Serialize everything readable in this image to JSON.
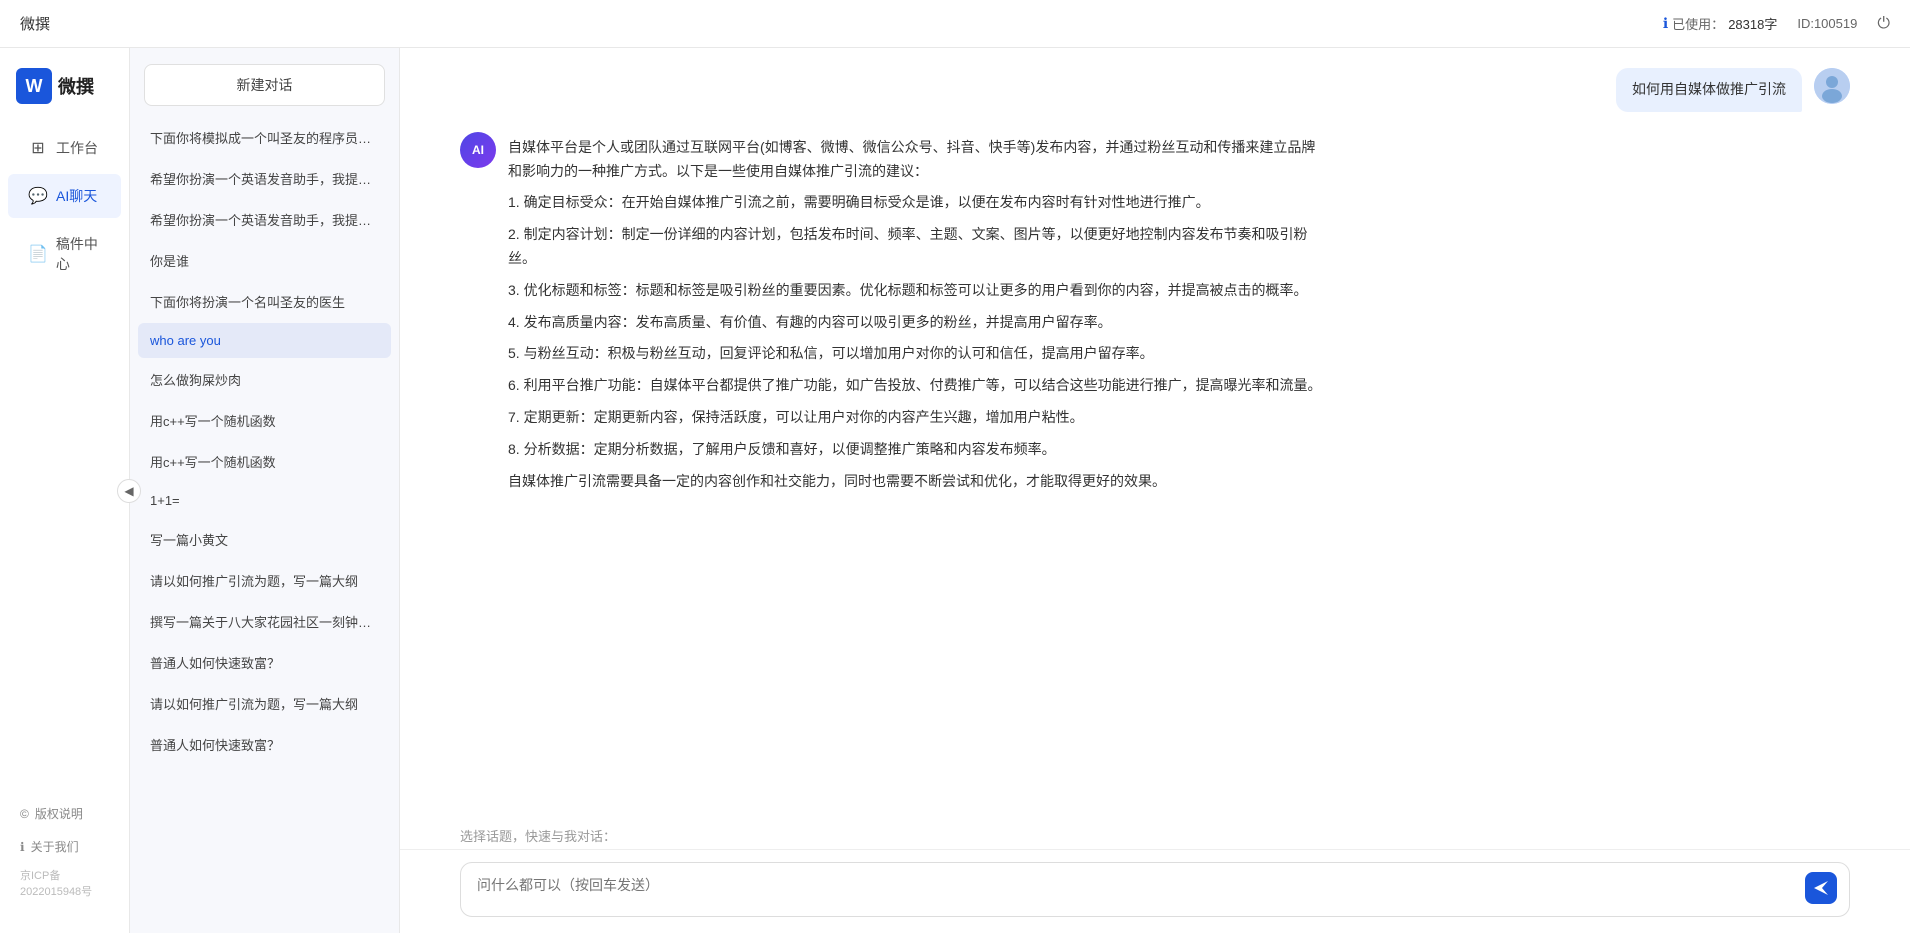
{
  "topbar": {
    "title": "微撰",
    "usage_label": "已使用：",
    "usage_value": "28318字",
    "id_label": "ID:100519",
    "logout_icon": "⏻"
  },
  "brand": {
    "logo_text": "W",
    "name": "微撰"
  },
  "nav": {
    "items": [
      {
        "id": "workbench",
        "label": "工作台",
        "icon": "⊞"
      },
      {
        "id": "aichat",
        "label": "AI聊天",
        "icon": "💬"
      },
      {
        "id": "drafts",
        "label": "稿件中心",
        "icon": "📄"
      }
    ],
    "bottom": [
      {
        "id": "copyright",
        "label": "版权说明",
        "icon": "©"
      },
      {
        "id": "about",
        "label": "关于我们",
        "icon": "ℹ"
      }
    ],
    "icp": "京ICP备2022015948号"
  },
  "sidebar": {
    "new_chat": "新建对话",
    "history": [
      {
        "id": 1,
        "label": "下面你将模拟成一个叫圣友的程序员，我说...",
        "active": false
      },
      {
        "id": 2,
        "label": "希望你扮演一个英语发音助手，我提供给你...",
        "active": false
      },
      {
        "id": 3,
        "label": "希望你扮演一个英语发音助手，我提供给你...",
        "active": false
      },
      {
        "id": 4,
        "label": "你是谁",
        "active": false
      },
      {
        "id": 5,
        "label": "下面你将扮演一个名叫圣友的医生",
        "active": false
      },
      {
        "id": 6,
        "label": "who are you",
        "active": true
      },
      {
        "id": 7,
        "label": "怎么做狗屎炒肉",
        "active": false
      },
      {
        "id": 8,
        "label": "用c++写一个随机函数",
        "active": false
      },
      {
        "id": 9,
        "label": "用c++写一个随机函数",
        "active": false
      },
      {
        "id": 10,
        "label": "1+1=",
        "active": false
      },
      {
        "id": 11,
        "label": "写一篇小黄文",
        "active": false
      },
      {
        "id": 12,
        "label": "请以如何推广引流为题，写一篇大纲",
        "active": false
      },
      {
        "id": 13,
        "label": "撰写一篇关于八大家花园社区一刻钟便民生...",
        "active": false
      },
      {
        "id": 14,
        "label": "普通人如何快速致富？",
        "active": false
      },
      {
        "id": 15,
        "label": "请以如何推广引流为题，写一篇大纲",
        "active": false
      },
      {
        "id": 16,
        "label": "普通人如何快速致富？",
        "active": false
      }
    ]
  },
  "chat": {
    "user_message": "如何用自媒体做推广引流",
    "ai_response": {
      "paragraphs": [
        "自媒体平台是个人或团队通过互联网平台(如博客、微博、微信公众号、抖音、快手等)发布内容，并通过粉丝互动和传播来建立品牌和影响力的一种推广方式。以下是一些使用自媒体推广引流的建议：",
        "1. 确定目标受众：在开始自媒体推广引流之前，需要明确目标受众是谁，以便在发布内容时有针对性地进行推广。",
        "2. 制定内容计划：制定一份详细的内容计划，包括发布时间、频率、主题、文案、图片等，以便更好地控制内容发布节奏和吸引粉丝。",
        "3. 优化标题和标签：标题和标签是吸引粉丝的重要因素。优化标题和标签可以让更多的用户看到你的内容，并提高被点击的概率。",
        "4. 发布高质量内容：发布高质量、有价值、有趣的内容可以吸引更多的粉丝，并提高用户留存率。",
        "5. 与粉丝互动：积极与粉丝互动，回复评论和私信，可以增加用户对你的认可和信任，提高用户留存率。",
        "6. 利用平台推广功能：自媒体平台都提供了推广功能，如广告投放、付费推广等，可以结合这些功能进行推广，提高曝光率和流量。",
        "7. 定期更新：定期更新内容，保持活跃度，可以让用户对你的内容产生兴趣，增加用户粘性。",
        "8. 分析数据：定期分析数据，了解用户反馈和喜好，以便调整推广策略和内容发布频率。",
        "自媒体推广引流需要具备一定的内容创作和社交能力，同时也需要不断尝试和优化，才能取得更好的效果。"
      ]
    },
    "suggestions_label": "选择话题，快速与我对话：",
    "input_placeholder": "问什么都可以（按回车发送）"
  }
}
